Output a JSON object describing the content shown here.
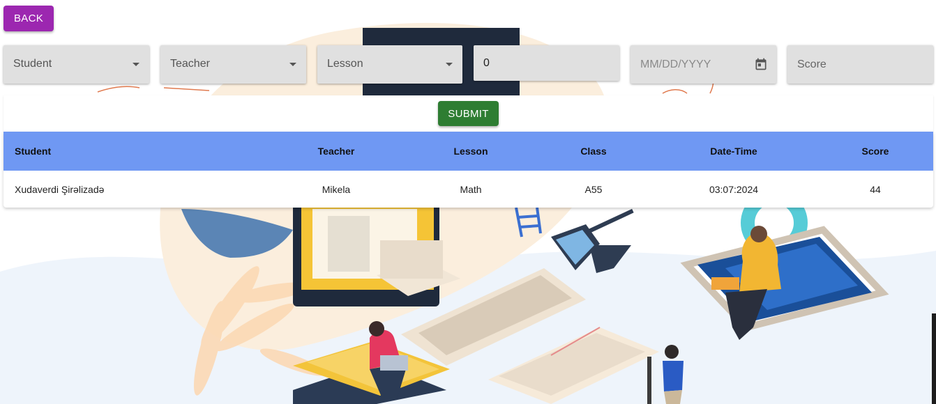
{
  "back_label": "BACK",
  "filters": {
    "student": "Student",
    "teacher": "Teacher",
    "lesson": "Lesson",
    "class_value": "0",
    "date_placeholder": "MM/DD/YYYY",
    "score_placeholder": "Score"
  },
  "submit_label": "SUBMIT",
  "table": {
    "headers": [
      "Student",
      "Teacher",
      "Lesson",
      "Class",
      "Date-Time",
      "Score"
    ],
    "rows": [
      [
        "Xudaverdi Şirəlizadə",
        "Mikela",
        "Math",
        "A55",
        "03:07:2024",
        "44"
      ]
    ]
  },
  "colors": {
    "back_button": "#9c27b0",
    "submit_button": "#2e7d32",
    "table_header": "#6f98f3",
    "field_background": "#e0e0e0"
  },
  "icons": {
    "dropdown": "caret-down-icon",
    "date": "calendar-icon"
  }
}
